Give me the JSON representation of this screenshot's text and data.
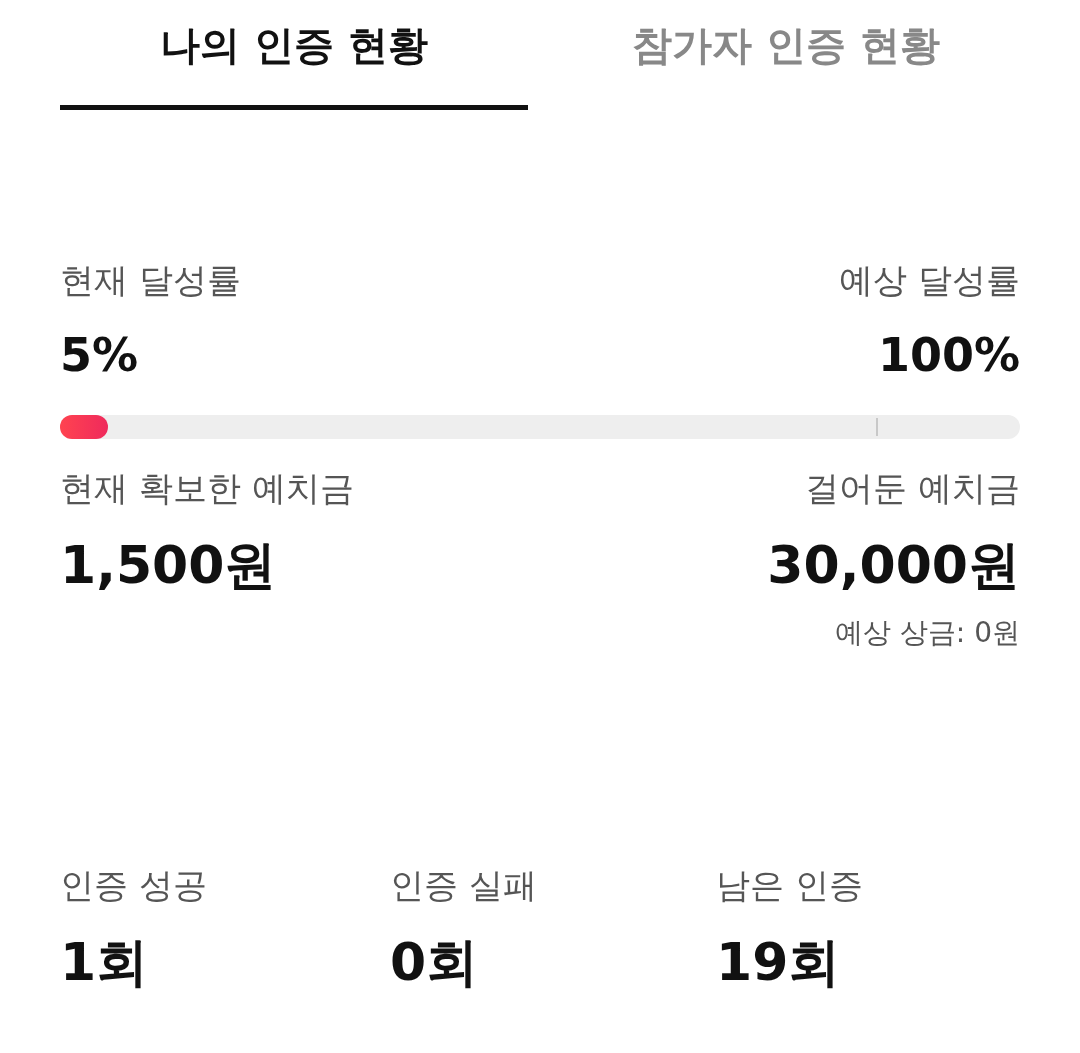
{
  "tabs": [
    {
      "label": "나의 인증 현황",
      "selected": true
    },
    {
      "label": "참가자 인증 현황",
      "selected": false
    }
  ],
  "achievement": {
    "current": {
      "label": "현재 달성률",
      "value": "5%"
    },
    "expected": {
      "label": "예상 달성률",
      "value": "100%"
    },
    "progress": {
      "level": 0.05
    },
    "expected_marker": {
      "level": 0.85
    }
  },
  "deposit": {
    "secured": {
      "label": "현재 확보한 예치금",
      "value": "1,500원"
    },
    "staked": {
      "label": "걸어둔 예치금",
      "value": "30,000원"
    },
    "expected_prize": "예상 상금: 0원"
  },
  "stats": [
    {
      "label": "인증 성공",
      "value": "1회"
    },
    {
      "label": "인증 실패",
      "value": "0회"
    },
    {
      "label": "남은 인증",
      "value": "19회"
    }
  ]
}
